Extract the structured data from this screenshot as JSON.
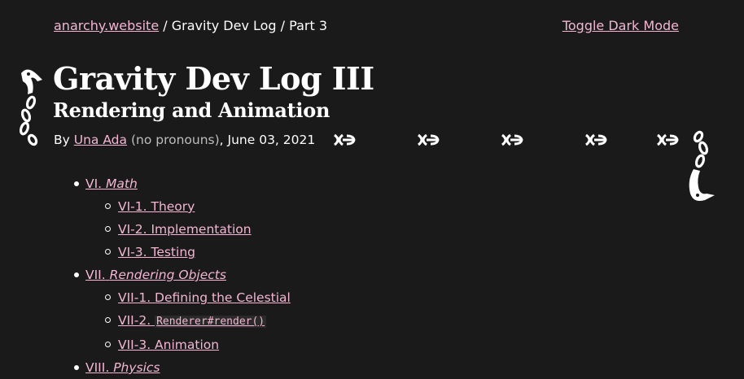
{
  "header": {
    "breadcrumb": {
      "home": "anarchy.website",
      "separator": "/",
      "section": "Gravity Dev Log",
      "current": "Part 3"
    },
    "toggle_label": "Toggle Dark Mode"
  },
  "article": {
    "title": "Gravity Dev Log III",
    "subtitle": "Rendering and Animation",
    "byline": {
      "prefix": "By",
      "author": "Una Ada",
      "pronouns": "(no pronouns)",
      "date": ", June 03, 2021"
    }
  },
  "toc": {
    "sections": [
      {
        "num": "VI.",
        "title": "Math",
        "items": [
          {
            "label": "VI-1. Theory"
          },
          {
            "label": "VI-2. Implementation"
          },
          {
            "label": "VI-3. Testing"
          }
        ]
      },
      {
        "num": "VII.",
        "title": "Rendering Objects",
        "items": [
          {
            "label": "VII-1. Defining the Celestial"
          },
          {
            "label": "VII-2.",
            "code": "Renderer#render()"
          },
          {
            "label": "VII-3. Animation"
          }
        ]
      },
      {
        "num": "VIII.",
        "title": "Physics",
        "items": []
      }
    ]
  },
  "decor": {
    "icons": [
      "serpent-icon",
      "chain-link-icon"
    ],
    "colors": {
      "background": "#1a1a1a",
      "text": "#ffffff",
      "link": "#f4b6d2",
      "muted": "#bdbdbd"
    }
  }
}
